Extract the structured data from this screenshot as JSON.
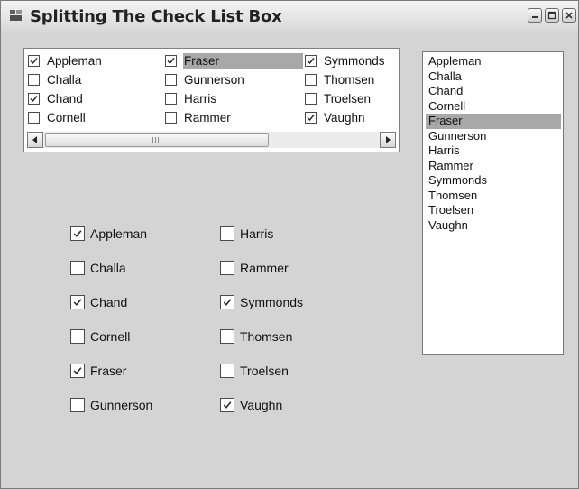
{
  "window": {
    "title": "Splitting The Check List Box"
  },
  "items": [
    "Appleman",
    "Challa",
    "Chand",
    "Cornell",
    "Fraser",
    "Gunnerson",
    "Harris",
    "Rammer",
    "Symmonds",
    "Thomsen",
    "Troelsen",
    "Vaughn"
  ],
  "multi_column_checked_list": {
    "rows": [
      [
        {
          "label": "Appleman",
          "checked": true
        },
        {
          "label": "Fraser",
          "checked": true,
          "selected": true
        },
        {
          "label": "Symmonds",
          "checked": true
        }
      ],
      [
        {
          "label": "Challa",
          "checked": false
        },
        {
          "label": "Gunnerson",
          "checked": false
        },
        {
          "label": "Thomsen",
          "checked": false
        }
      ],
      [
        {
          "label": "Chand",
          "checked": true
        },
        {
          "label": "Harris",
          "checked": false
        },
        {
          "label": "Troelsen",
          "checked": false
        }
      ],
      [
        {
          "label": "Cornell",
          "checked": false
        },
        {
          "label": "Rammer",
          "checked": false
        },
        {
          "label": "Vaughn",
          "checked": true
        }
      ]
    ]
  },
  "list_box": {
    "items": [
      "Appleman",
      "Challa",
      "Chand",
      "Cornell",
      "Fraser",
      "Gunnerson",
      "Harris",
      "Rammer",
      "Symmonds",
      "Thomsen",
      "Troelsen",
      "Vaughn"
    ],
    "selected": "Fraser"
  },
  "split_checkboxes": {
    "left": [
      {
        "label": "Appleman",
        "checked": true
      },
      {
        "label": "Challa",
        "checked": false
      },
      {
        "label": "Chand",
        "checked": true
      },
      {
        "label": "Cornell",
        "checked": false
      },
      {
        "label": "Fraser",
        "checked": true
      },
      {
        "label": "Gunnerson",
        "checked": false
      }
    ],
    "right": [
      {
        "label": "Harris",
        "checked": false
      },
      {
        "label": "Rammer",
        "checked": false
      },
      {
        "label": "Symmonds",
        "checked": true
      },
      {
        "label": "Thomsen",
        "checked": false
      },
      {
        "label": "Troelsen",
        "checked": false
      },
      {
        "label": "Vaughn",
        "checked": true
      }
    ]
  }
}
